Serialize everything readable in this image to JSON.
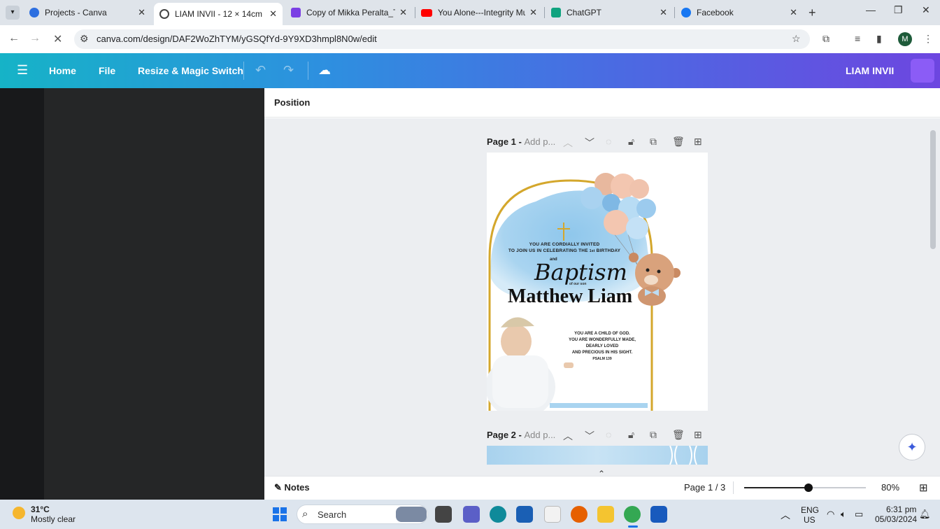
{
  "browser": {
    "tabs": [
      {
        "label": "Projects - Canva",
        "icon": "canva-icon",
        "color": "#2d6fe0"
      },
      {
        "label": "LIAM INVII - 12 × 14cm",
        "icon": "canva-edit-icon",
        "color": "#444444"
      },
      {
        "label": "Copy of Mikka Peralta_TEA",
        "icon": "canva-doc-icon",
        "color": "#7b3fe4"
      },
      {
        "label": "You Alone---Integrity Musi",
        "icon": "youtube-icon",
        "color": "#ff0000"
      },
      {
        "label": "ChatGPT",
        "icon": "chatgpt-icon",
        "color": "#10a37f"
      },
      {
        "label": "Facebook",
        "icon": "facebook-icon",
        "color": "#1877f2"
      }
    ],
    "url": "canva.com/design/DAF2WoZhTYM/yGSQfYd-9Y9XD3hmpl8N0w/edit",
    "profile_initial": "M"
  },
  "canva": {
    "menu": {
      "home": "Home",
      "file": "File",
      "resize": "Resize & Magic Switch"
    },
    "design_title": "LIAM INVII",
    "context_toolbar": {
      "position": "Position"
    },
    "pages": [
      {
        "label": "Page 1",
        "title_placeholder": "Add p..."
      },
      {
        "label": "Page 2",
        "title_placeholder": "Add p..."
      }
    ],
    "invitation": {
      "line1": "YOU ARE CORDIALLY INVITED",
      "line2_pre": "TO JOIN US IN CELEBRATING THE ",
      "line2_ord": "1st",
      "line2_post": " BIRTHDAY",
      "and": "and",
      "script_title": "Baptism",
      "of_our_son": "of our son",
      "name": "Matthew Liam",
      "verse": [
        "YOU ARE A CHILD OF GOD.",
        "YOU ARE WONDERFULLY MADE,",
        "DEARLY LOVED",
        "AND PRECIOUS IN HIS SIGHT."
      ],
      "verse_ref": "PSALM 139"
    },
    "bottom": {
      "notes": "Notes",
      "page_count": "Page 1 / 3",
      "zoom_label": "80%",
      "zoom_level": 0.53
    }
  },
  "taskbar": {
    "weather_temp": "31°C",
    "weather_desc": "Mostly clear",
    "search_placeholder": "Search",
    "lang_line1": "ENG",
    "lang_line2": "US",
    "time": "6:31 pm",
    "date": "05/03/2024"
  },
  "colors": {
    "accent_teal": "#16b3c7",
    "accent_purple": "#6d46e0",
    "gold": "#d4a72c",
    "sky_blue": "#a8d2ee"
  }
}
